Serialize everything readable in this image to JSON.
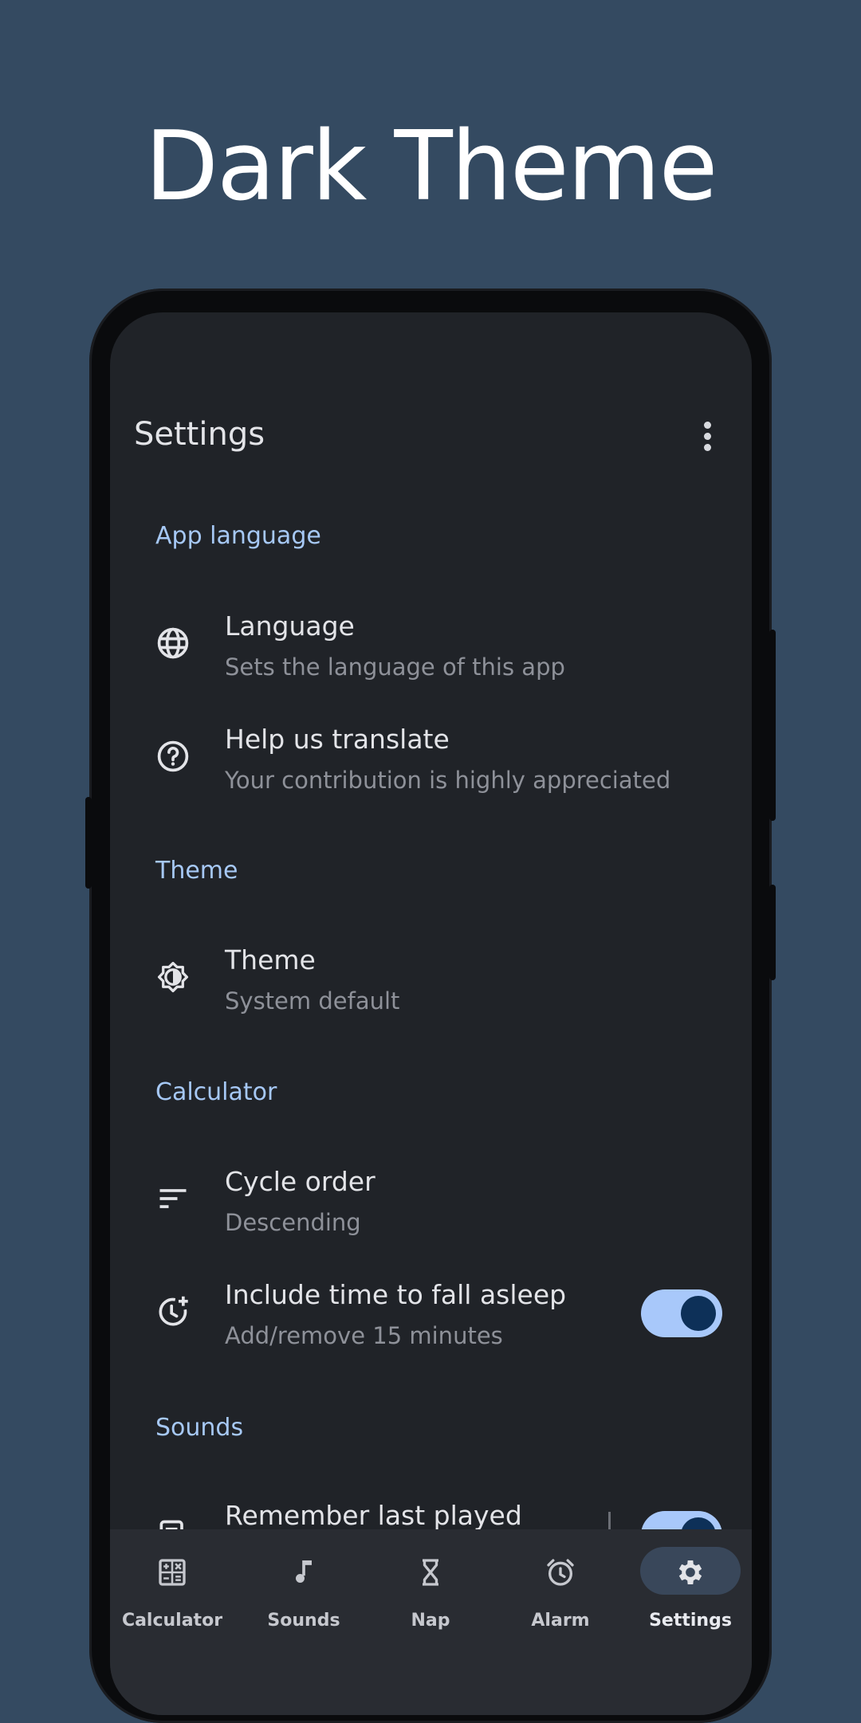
{
  "headline": "Dark Theme",
  "appbar": {
    "title": "Settings",
    "menu_icon": "more-vert-icon"
  },
  "sections": {
    "app_language": "App language",
    "theme": "Theme",
    "calculator": "Calculator",
    "sounds": "Sounds"
  },
  "items": {
    "language": {
      "title": "Language",
      "subtitle": "Sets the language of this app",
      "icon": "globe-icon"
    },
    "translate": {
      "title": "Help us translate",
      "subtitle": "Your contribution is highly appreciated",
      "icon": "help-icon"
    },
    "theme": {
      "title": "Theme",
      "subtitle": "System default",
      "icon": "brightness-icon"
    },
    "cycle_order": {
      "title": "Cycle order",
      "subtitle": "Descending",
      "icon": "sort-icon"
    },
    "fall_asleep": {
      "title": "Include time to fall asleep",
      "subtitle": "Add/remove 15 minutes",
      "icon": "clock-plus-icon",
      "enabled": true
    },
    "remember_last": {
      "title": "Remember last played",
      "icon": "playlist-icon",
      "enabled": true
    }
  },
  "nav": [
    {
      "label": "Calculator",
      "icon": "calculator-icon",
      "selected": false
    },
    {
      "label": "Sounds",
      "icon": "music-note-icon",
      "selected": false
    },
    {
      "label": "Nap",
      "icon": "hourglass-icon",
      "selected": false
    },
    {
      "label": "Alarm",
      "icon": "alarm-icon",
      "selected": false
    },
    {
      "label": "Settings",
      "icon": "gear-icon",
      "selected": true
    }
  ],
  "colors": {
    "background": "#344a61",
    "screen": "#202328",
    "accent": "#a6c8f5",
    "toggle_track": "#a8c8fa",
    "toggle_knob": "#0d3058",
    "nav_selected_pill": "#39475a"
  }
}
